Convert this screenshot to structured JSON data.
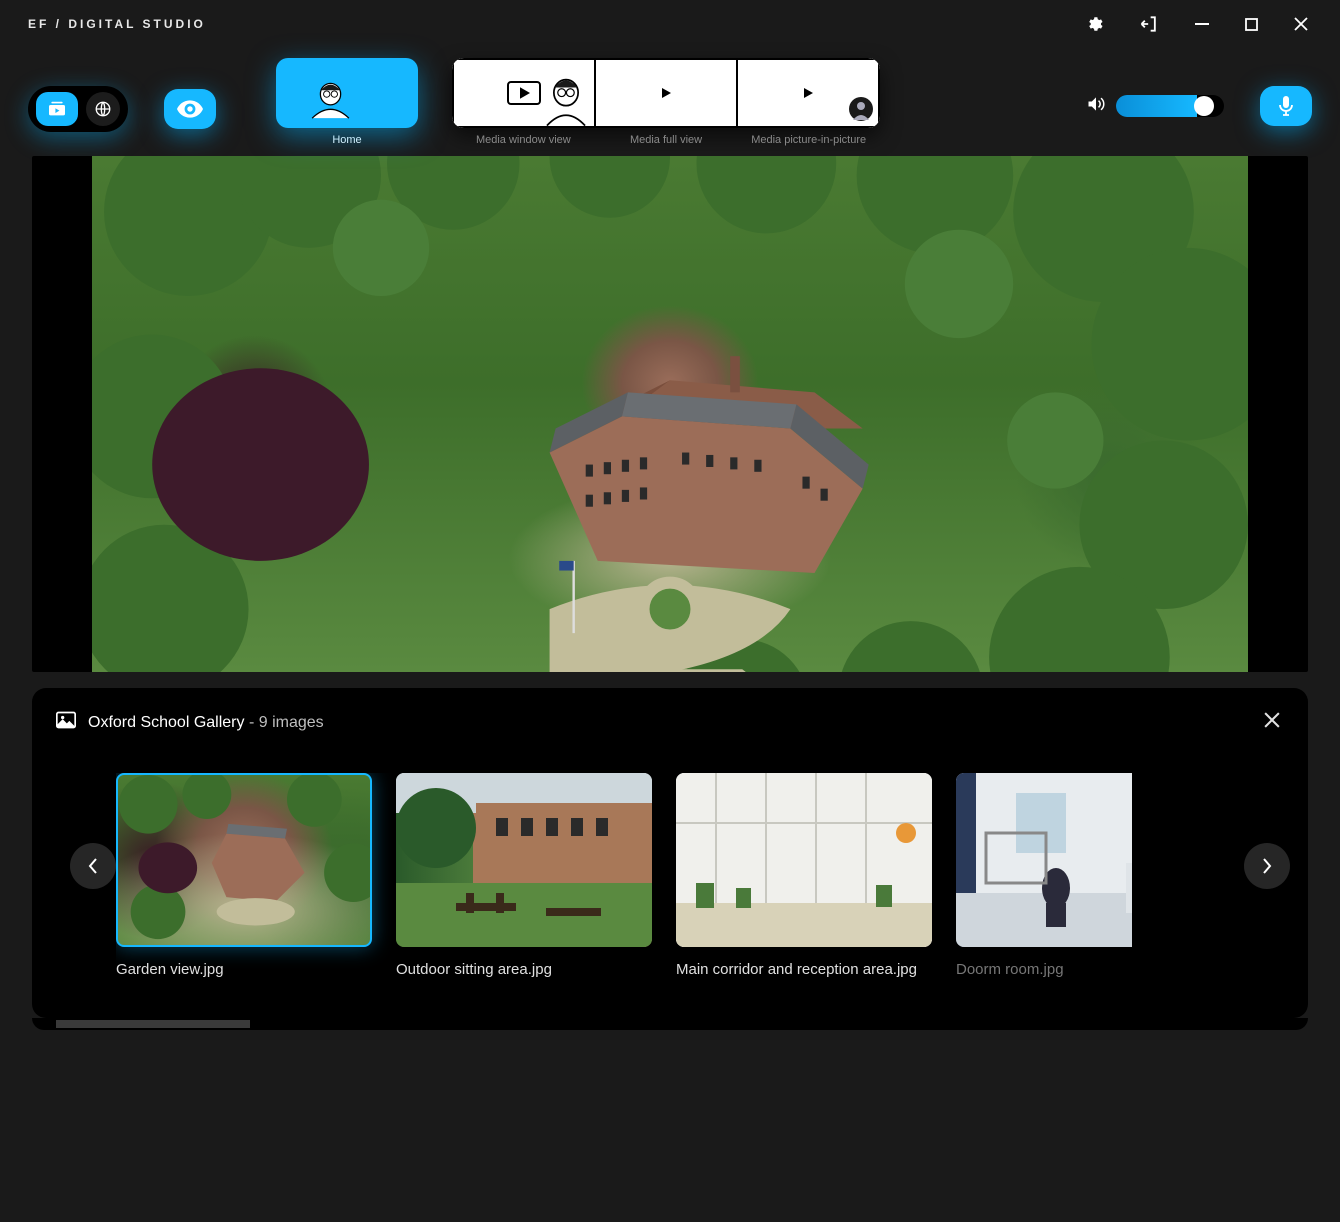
{
  "app": {
    "title": "EF / DIGITAL STUDIO"
  },
  "window_controls": [
    "settings",
    "logout",
    "minimize",
    "maximize",
    "close"
  ],
  "toolbar": {
    "left_icons": [
      "media-library",
      "globe",
      "visibility"
    ],
    "right_icons": [
      "volume",
      "mic"
    ],
    "volume_percent": 75
  },
  "view_tabs": {
    "active": "home",
    "home_label": "Home",
    "triplet_labels": [
      "Media window view",
      "Media full view",
      "Media picture-in-picture"
    ]
  },
  "main_image": {
    "description": "Aerial view of a large collegiate brick building complex surrounded by dense green trees and lawns, with a circular driveway and flagpole in front."
  },
  "gallery": {
    "icon": "image",
    "title_prefix": "Oxford School Gallery",
    "count_text": " - 9 images",
    "selected_index": 0,
    "items": [
      {
        "label": "Garden view.jpg",
        "scene_class": "scene-aerial"
      },
      {
        "label": "Outdoor sitting area.jpg",
        "scene_class": "scene-outdoor"
      },
      {
        "label": "Main corridor and reception area.jpg",
        "scene_class": "scene-corridor"
      },
      {
        "label": "Doorm room.jpg",
        "scene_class": "scene-dorm"
      }
    ]
  },
  "colors": {
    "accent": "#16b8ff",
    "bg": "#1a1a1a",
    "panel": "#000000"
  }
}
